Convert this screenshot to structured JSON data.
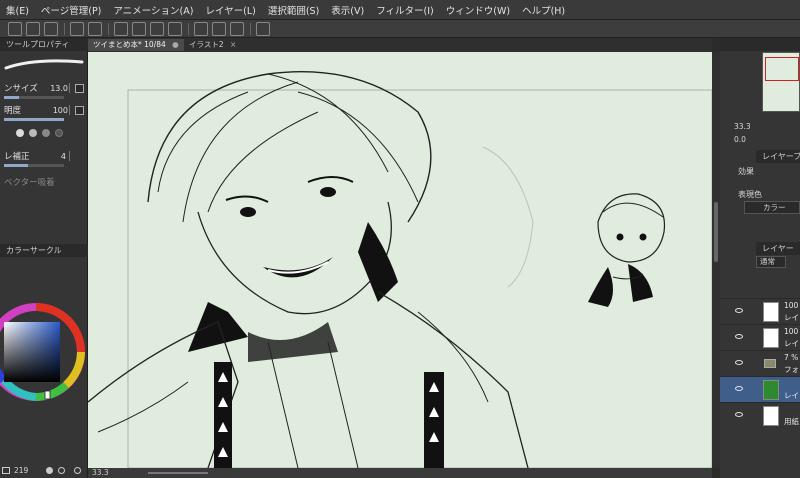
{
  "menu": [
    "集(E)",
    "ページ管理(P)",
    "アニメーション(A)",
    "レイヤー(L)",
    "選択範囲(S)",
    "表示(V)",
    "フィルター(I)",
    "ウィンドウ(W)",
    "ヘルプ(H)"
  ],
  "tool_property": {
    "tab_label": "ツールプロパティ",
    "brush_size_label": "ンサイズ",
    "brush_size_value": "13.0",
    "opacity_label": "明度",
    "opacity_value": "100",
    "stabilization_label": "レ補正",
    "stabilization_value": "4",
    "vector_snap_label": "ベクター吸着"
  },
  "color_circle": {
    "tab_label": "カラーサークル",
    "footer_value": "219"
  },
  "document_tabs": [
    {
      "label": "ツイまとめ本* 10/84"
    },
    {
      "label": "イラスト2"
    }
  ],
  "canvas": {
    "zoom": "33.3",
    "background_color": "#e0edde"
  },
  "navigator": {
    "zoom": "33.3",
    "angle": "0.0"
  },
  "layer_property": {
    "tab_label": "レイヤープロパティ",
    "effect_label": "効果",
    "expression_color_label": "表現色",
    "expression_color_value": "カラー"
  },
  "layers": {
    "tab_label": "レイヤー",
    "blend_mode": "通常",
    "items": [
      {
        "opacity": "100",
        "name": "レイ"
      },
      {
        "opacity": "100",
        "name": "レイ"
      },
      {
        "opacity": "7 %",
        "name": "フォ"
      },
      {
        "opacity": "",
        "name": "レイ"
      },
      {
        "opacity": "",
        "name": "用紙"
      }
    ]
  }
}
